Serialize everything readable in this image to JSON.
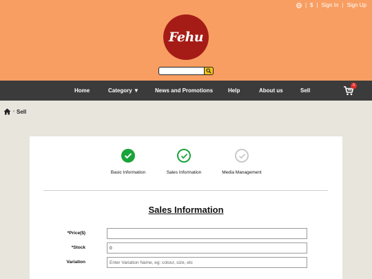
{
  "top_bar": {
    "currency": "$",
    "sign_in": "Sign In",
    "sign_up": "Sign Up",
    "separator": "|",
    "globe_icon": "globe-icon"
  },
  "logo": {
    "text": "Fehu"
  },
  "search": {
    "placeholder": "",
    "icon": "search-icon"
  },
  "nav": {
    "items": [
      "Home",
      "Category",
      "News and Promotions",
      "Help",
      "About us",
      "Sell"
    ],
    "category_caret": "▼",
    "cart_count": "0",
    "cart_icon": "cart-icon"
  },
  "breadcrumb": {
    "home_icon": "home-icon",
    "arrow": "›",
    "current": "Sell"
  },
  "steps": [
    {
      "label": "Basic Information",
      "state": "done"
    },
    {
      "label": "Sales Information",
      "state": "current"
    },
    {
      "label": "Media Management",
      "state": "pending"
    }
  ],
  "section_title": "Sales Information",
  "form": {
    "price_label": "*Price($)",
    "price_value": "",
    "stock_label": "*Stock",
    "stock_value": "0",
    "variation_label": "Variation",
    "variation_placeholder": "Enter Variation Name, eg: colour, size, etc"
  },
  "colors": {
    "header_bg": "#f89e62",
    "logo_bg": "#a51c17",
    "nav_bg": "#3b3b3b",
    "step_done": "#1aa33a",
    "step_pending": "#c9c9c9",
    "search_button": "#f3c21a"
  }
}
